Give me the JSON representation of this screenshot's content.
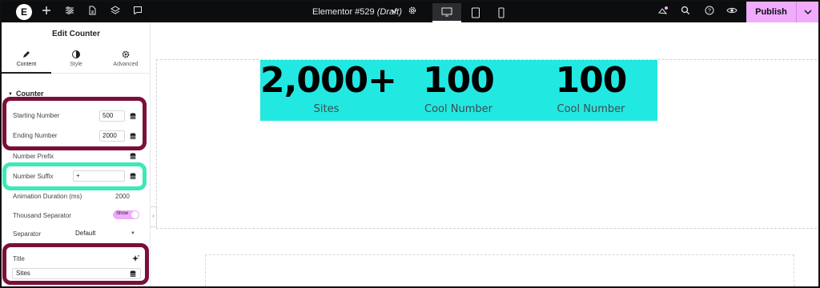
{
  "topbar": {
    "document_title": "Elementor #529",
    "document_status": "(Draft)",
    "publish_label": "Publish",
    "icons": [
      "elementor-logo-icon",
      "plus-icon",
      "sliders-icon",
      "page-icon",
      "layers-icon",
      "comment-icon",
      "chevron-down-icon",
      "gear-icon",
      "desktop-icon",
      "tablet-icon",
      "mobile-icon",
      "notifications-icon",
      "search-icon",
      "help-icon",
      "eye-icon"
    ]
  },
  "panel": {
    "title": "Edit Counter",
    "tabs": [
      {
        "label": "Content",
        "icon": "pencil-icon",
        "active": true
      },
      {
        "label": "Style",
        "icon": "half-circle-icon",
        "active": false
      },
      {
        "label": "Advanced",
        "icon": "gear-icon",
        "active": false
      }
    ],
    "section_title": "Counter",
    "controls": {
      "starting_number": {
        "label": "Starting Number",
        "value": "500"
      },
      "ending_number": {
        "label": "Ending Number",
        "value": "2000"
      },
      "number_prefix": {
        "label": "Number Prefix"
      },
      "number_suffix": {
        "label": "Number Suffix",
        "value": "+"
      },
      "animation_duration": {
        "label": "Animation Duration (ms)",
        "value": "2000"
      },
      "thousand_separator": {
        "label": "Thousand Separator",
        "toggle_label": "Show",
        "on": true
      },
      "separator": {
        "label": "Separator",
        "value": "Default"
      },
      "title": {
        "label": "Title",
        "value": "Sites"
      }
    }
  },
  "canvas": {
    "counters": [
      {
        "number": "2,000+",
        "title": "Sites"
      },
      {
        "number": "100",
        "title": "Cool Number"
      },
      {
        "number": "100",
        "title": "Cool Number"
      }
    ],
    "section_background": "#22e8e2"
  },
  "colors": {
    "accent_pink": "#f0abfc",
    "highlight_red": "#7b0f3a",
    "highlight_teal": "#3ee8b8",
    "topbar_bg": "#0c0d0e"
  }
}
